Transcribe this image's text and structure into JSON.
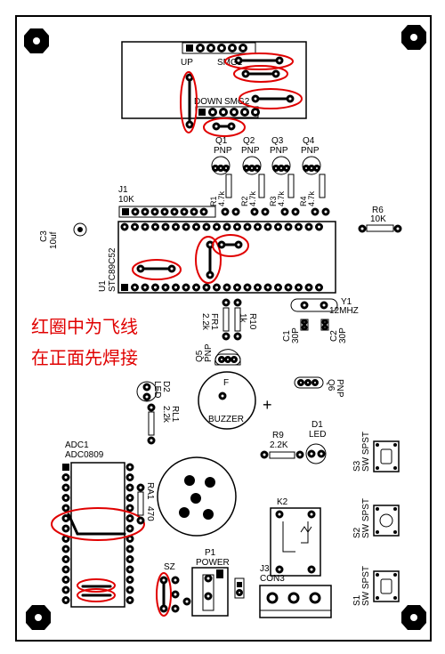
{
  "notes": {
    "line1": "红圈中为飞线",
    "line2": "在正面先焊接"
  },
  "headers": {
    "up_label": "UP",
    "smg1_label": "SMG1",
    "down_label": "DOWN",
    "smg2_label": "SMG2"
  },
  "transistors": [
    {
      "name": "Q1",
      "type": "PNP",
      "resistor": "R1",
      "rvalue": "4.7k"
    },
    {
      "name": "Q2",
      "type": "PNP",
      "resistor": "R2",
      "rvalue": "4.7k"
    },
    {
      "name": "Q3",
      "type": "PNP",
      "resistor": "R3",
      "rvalue": "4.7k"
    },
    {
      "name": "Q4",
      "type": "PNP",
      "resistor": "R4",
      "rvalue": "4.7k"
    }
  ],
  "j1": {
    "name": "J1",
    "value": "10K"
  },
  "r6": {
    "name": "R6",
    "value": "10K"
  },
  "c3": {
    "name": "C3",
    "value": "10uf"
  },
  "u1": {
    "name": "U1",
    "part": "STC89C52"
  },
  "fr1": {
    "name": "FR1",
    "value": "2.2k"
  },
  "r10": {
    "name": "R10",
    "value": "1k"
  },
  "y1": {
    "name": "Y1",
    "value": "12MHZ"
  },
  "c1": {
    "name": "C1",
    "value": "30P"
  },
  "c2": {
    "name": "C2",
    "value": "30P"
  },
  "q5": {
    "name": "Q5",
    "type": "PNP"
  },
  "q6": {
    "name": "Q6",
    "type": "PNP"
  },
  "d2": {
    "name": "D2",
    "type": "LED"
  },
  "rl1": {
    "name": "RL1",
    "value": "2.2k"
  },
  "buzzer": {
    "label": "BUZZER",
    "pin": "F",
    "plus": "+"
  },
  "r9": {
    "name": "R9",
    "value": "2.2K"
  },
  "d1": {
    "name": "D1",
    "type": "LED"
  },
  "adc1": {
    "name": "ADC1",
    "part": "ADC0809"
  },
  "ra1": {
    "name": "RA1",
    "value": "470"
  },
  "k2": {
    "name": "K2"
  },
  "switches": [
    {
      "name": "S3",
      "type": "SW SPST"
    },
    {
      "name": "S2",
      "type": "SW SPST"
    },
    {
      "name": "S1",
      "type": "SW SPST"
    }
  ],
  "p1": {
    "name": "P1",
    "label": "POWER"
  },
  "sz": {
    "name": "SZ"
  },
  "j3": {
    "name": "J3",
    "label": "CON3"
  }
}
